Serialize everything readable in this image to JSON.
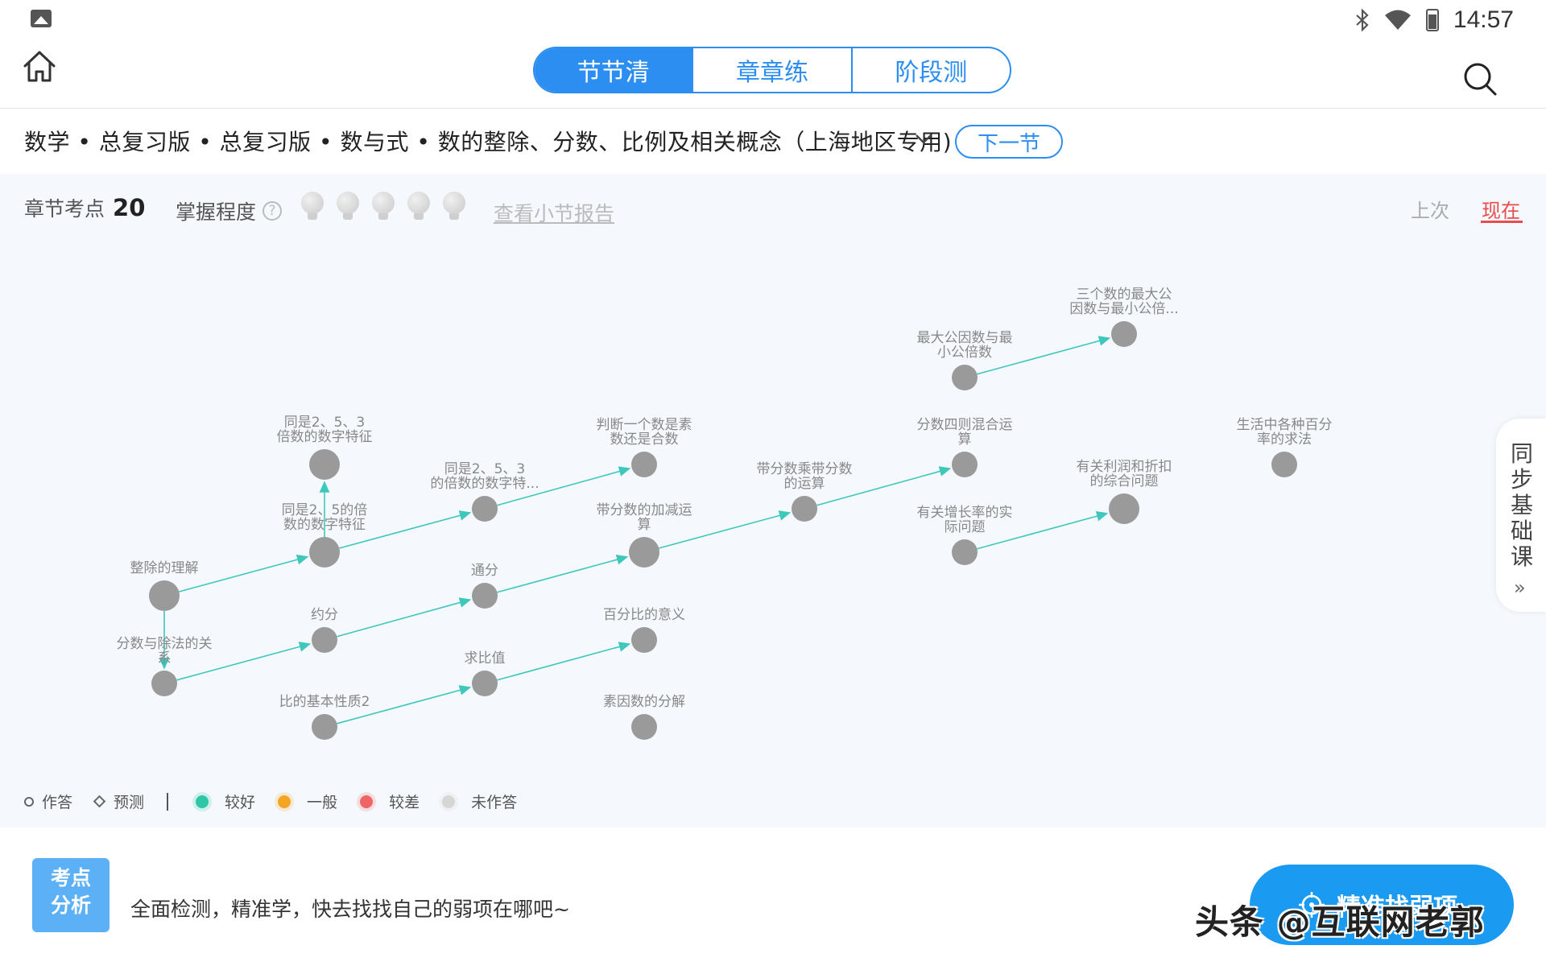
{
  "status_bar": {
    "time": "14:57",
    "icons": [
      "gallery-icon",
      "bluetooth-icon",
      "wifi-icon",
      "battery-icon"
    ]
  },
  "tabs": [
    "节节清",
    "章章练",
    "阶段测"
  ],
  "breadcrumb": "数学 • 总复习版 • 总复习版 • 数与式 • 数的整除、分数、比例及相关概念（上海地区专用)",
  "next_button": "下一节",
  "stats": {
    "label": "章节考点",
    "count": "20",
    "mastery_label": "掌握程度",
    "help": "?",
    "report_link": "查看小节报告"
  },
  "toggle": {
    "last": "上次",
    "now": "现在"
  },
  "nodes": [
    {
      "id": "n1",
      "label": "整除的理解",
      "status": "未作答"
    },
    {
      "id": "n2",
      "label": "分数与除法的关系",
      "status": "未作答"
    },
    {
      "id": "n3",
      "label": "同是2、5的倍数的数字特征",
      "status": "未作答"
    },
    {
      "id": "n4",
      "label": "同是2、5、3倍数的数字特征",
      "status": "未作答"
    },
    {
      "id": "n5",
      "label": "约分",
      "status": "未作答"
    },
    {
      "id": "n6",
      "label": "比的基本性质2",
      "status": "未作答"
    },
    {
      "id": "n7",
      "label": "同是2、5、3的倍数的数字特...",
      "status": "未作答"
    },
    {
      "id": "n8",
      "label": "通分",
      "status": "未作答"
    },
    {
      "id": "n9",
      "label": "求比值",
      "status": "未作答"
    },
    {
      "id": "n10",
      "label": "判断一个数是素数还是合数",
      "status": "未作答"
    },
    {
      "id": "n11",
      "label": "带分数的加减运算",
      "status": "未作答"
    },
    {
      "id": "n12",
      "label": "百分比的意义",
      "status": "未作答"
    },
    {
      "id": "n13",
      "label": "素因数的分解",
      "status": "未作答"
    },
    {
      "id": "n14",
      "label": "带分数乘带分数的运算",
      "status": "未作答"
    },
    {
      "id": "n15",
      "label": "最大公因数与最小公倍数",
      "status": "未作答"
    },
    {
      "id": "n16",
      "label": "分数四则混合运算",
      "status": "未作答"
    },
    {
      "id": "n17",
      "label": "有关增长率的实际问题",
      "status": "未作答"
    },
    {
      "id": "n18",
      "label": "三个数的最大公因数与最小公倍...",
      "status": "未作答"
    },
    {
      "id": "n19",
      "label": "有关利润和折扣的综合问题",
      "status": "未作答"
    },
    {
      "id": "n20",
      "label": "生活中各种百分率的求法",
      "status": "未作答"
    }
  ],
  "edges": [
    [
      "n1",
      "n3"
    ],
    [
      "n1",
      "n2"
    ],
    [
      "n2",
      "n5"
    ],
    [
      "n3",
      "n4"
    ],
    [
      "n3",
      "n7"
    ],
    [
      "n5",
      "n8"
    ],
    [
      "n6",
      "n9"
    ],
    [
      "n7",
      "n10"
    ],
    [
      "n8",
      "n11"
    ],
    [
      "n9",
      "n12"
    ],
    [
      "n11",
      "n14"
    ],
    [
      "n14",
      "n16"
    ],
    [
      "n15",
      "n18"
    ],
    [
      "n17",
      "n19"
    ]
  ],
  "side_tab": {
    "label": "同步基础课",
    "chevron": "»"
  },
  "legend": {
    "answered": "作答",
    "predicted": "预测",
    "levels": [
      {
        "label": "较好",
        "color": "#2fc7a6"
      },
      {
        "label": "一般",
        "color": "#f5a623"
      },
      {
        "label": "较差",
        "color": "#ef6464"
      },
      {
        "label": "未作答",
        "color": "#d6d6d6"
      }
    ]
  },
  "bottom": {
    "badge_line1": "考点",
    "badge_line2": "分析",
    "tip": "全面检测，精准学，快去找找自己的弱项在哪吧~",
    "button": "精准找弱项"
  },
  "watermark": "头条 @互联网老郭",
  "colors": {
    "accent": "#2b8ef0",
    "edge": "#3ec8bb",
    "node": "#9a9a9a",
    "now": "#e84c4c"
  }
}
